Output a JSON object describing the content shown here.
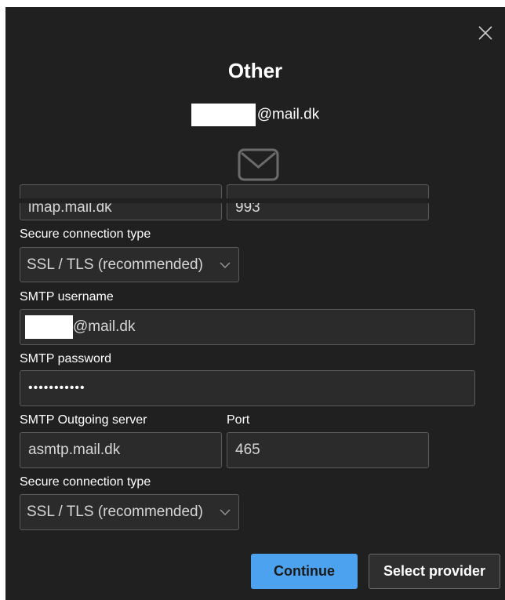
{
  "dialog": {
    "title": "Other",
    "email_suffix": "@mail.dk",
    "close_icon": "close-icon",
    "envelope_icon": "mail-envelope-icon"
  },
  "incoming": {
    "server_value": "imap.mail.dk",
    "port_value": "993",
    "secure_label": "Secure connection type",
    "secure_value": "SSL / TLS (recommended)"
  },
  "smtp": {
    "username_label": "SMTP username",
    "username_value": "@mail.dk",
    "password_label": "SMTP password",
    "password_value": "•••••••••••",
    "server_label": "SMTP Outgoing server",
    "server_value": "asmtp.mail.dk",
    "port_label": "Port",
    "port_value": "465",
    "secure_label": "Secure connection type",
    "secure_value": "SSL / TLS (recommended)"
  },
  "buttons": {
    "continue": "Continue",
    "select_provider": "Select provider"
  },
  "colors": {
    "background": "#202020",
    "accent": "#4ca2ee",
    "field_border": "#5a5a5a"
  }
}
